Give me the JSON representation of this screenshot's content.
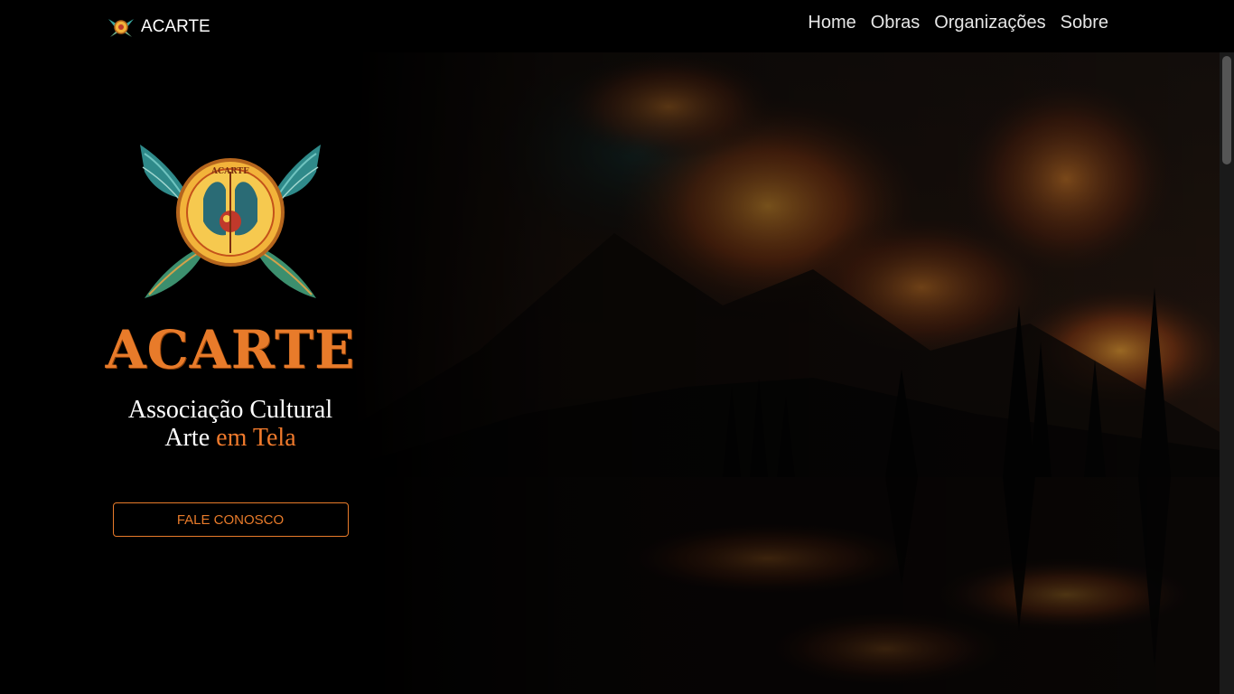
{
  "navbar": {
    "brand_name": "ACARTE",
    "brand_icon": "acarte-logo-icon",
    "links": [
      "Home",
      "Obras",
      "Organizações",
      "Sobre"
    ]
  },
  "hero": {
    "title": "ACARTE",
    "subtitle_line1": "Associação Cultural",
    "subtitle_line2_plain": "Arte",
    "subtitle_line2_accent": "em Tela",
    "cta_label": "FALE CONOSCO",
    "logo_ring_text": "Associação Cultural Arte em Tela",
    "logo_top_text": "ACARTE"
  },
  "colors": {
    "accent": "#e87b2a",
    "background": "#000000",
    "text": "#ffffff"
  }
}
